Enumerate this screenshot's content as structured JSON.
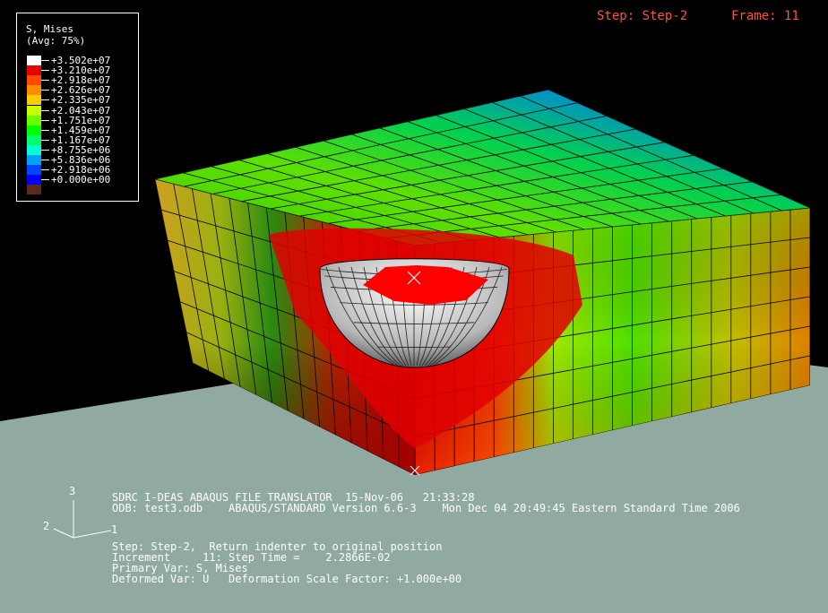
{
  "legend": {
    "title": "S, Mises",
    "subtitle": "(Avg: 75%)",
    "levels": [
      {
        "label": "+3.502e+07",
        "color": "#ffffff"
      },
      {
        "label": "+3.210e+07",
        "color": "#e80000"
      },
      {
        "label": "+2.918e+07",
        "color": "#ff4a00"
      },
      {
        "label": "+2.626e+07",
        "color": "#ff8c00"
      },
      {
        "label": "+2.335e+07",
        "color": "#ffcc00"
      },
      {
        "label": "+2.043e+07",
        "color": "#c8ff00"
      },
      {
        "label": "+1.751e+07",
        "color": "#6aff00"
      },
      {
        "label": "+1.459e+07",
        "color": "#00ff00"
      },
      {
        "label": "+1.167e+07",
        "color": "#00ff6a"
      },
      {
        "label": "+8.755e+06",
        "color": "#00ffd2"
      },
      {
        "label": "+5.836e+06",
        "color": "#00a0ff"
      },
      {
        "label": "+2.918e+06",
        "color": "#0048ff"
      },
      {
        "label": "+0.000e+00",
        "color": "#0000ff"
      }
    ],
    "bottom_swatch_color": "#5a2a1a"
  },
  "header": {
    "step": "Step: Step-2",
    "frame": "Frame: 11"
  },
  "triad": {
    "x": "1",
    "y": "2",
    "z": "3"
  },
  "info": {
    "line1": "SDRC I-DEAS ABAQUS FILE TRANSLATOR  15-Nov-06   21:33:28",
    "line2": "ODB: test3.odb    ABAQUS/STANDARD Version 6.6-3    Mon Dec 04 20:49:45 Eastern Standard Time 2006",
    "line3": "Step: Step-2,  Return indenter to original position",
    "line4": "Increment     11: Step Time =    2.2866E-02",
    "line5": "Primary Var: S, Mises",
    "line6": "Deformed Var: U   Deformation Scale Factor: +1.000e+00"
  },
  "colors": {
    "background": "#000000",
    "ground": "#90aaa2",
    "header_text": "#ff5040"
  }
}
